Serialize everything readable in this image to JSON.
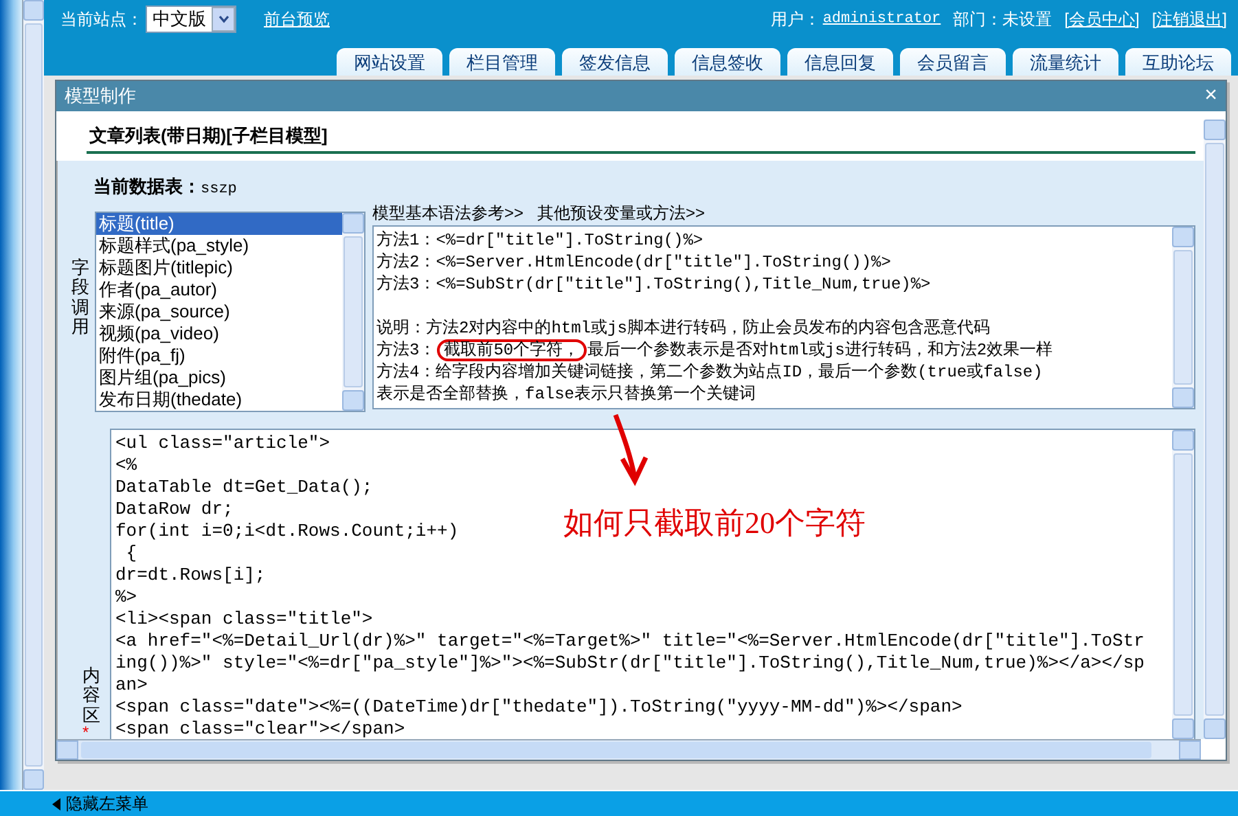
{
  "header": {
    "site_label": "当前站点：",
    "site_select": "中文版",
    "preview_link": "前台预览",
    "user_label": "用户：",
    "user_link": "administrator",
    "department": "部门：未设置",
    "member_center": "[会员中心]",
    "logout": "[注销退出]"
  },
  "tabs": [
    "网站设置",
    "栏目管理",
    "签发信息",
    "信息签收",
    "信息回复",
    "会员留言",
    "流量统计",
    "互助论坛"
  ],
  "dialog": {
    "title": "模型制作",
    "close": "×",
    "heading": "文章列表(带日期)[子栏目模型]",
    "table_label": "当前数据表：",
    "table_name": "sszp",
    "fields_label": "字段调用",
    "fields": [
      {
        "label": "标题(title)",
        "selected": true
      },
      {
        "label": "标题样式(pa_style)",
        "selected": false
      },
      {
        "label": "标题图片(titlepic)",
        "selected": false
      },
      {
        "label": "作者(pa_autor)",
        "selected": false
      },
      {
        "label": "来源(pa_source)",
        "selected": false
      },
      {
        "label": "视频(pa_video)",
        "selected": false
      },
      {
        "label": "附件(pa_fj)",
        "selected": false
      },
      {
        "label": "图片组(pa_pics)",
        "selected": false
      },
      {
        "label": "发布日期(thedate)",
        "selected": false
      }
    ],
    "syntax_links": [
      "模型基本语法参考>>",
      "其他预设变量或方法>>"
    ],
    "syntax_examples": [
      "方法1：<%=dr[\"title\"].ToString()%>",
      "方法2：<%=Server.HtmlEncode(dr[\"title\"].ToString())%>",
      "方法3：<%=SubStr(dr[\"title\"].ToString(),Title_Num,true)%>"
    ],
    "syntax_notes": [
      {
        "text": "说明：方法2对内容中的html或js脚本进行转码，防止会员发布的内容包含恶意代码"
      },
      {
        "text": "方法3：",
        "circled_text": "截取前50个字符，",
        "rest": "最后一个参数表示是否对html或js进行转码，和方法2效果一样"
      },
      {
        "text": "方法4：给字段内容增加关键词链接，第二个参数为站点ID，最后一个参数(true或false)"
      },
      {
        "text": "表示是否全部替换，false表示只替换第一个关键词"
      }
    ],
    "content_label": "内容区",
    "required_mark": "*",
    "code_lines": [
      "<ul class=\"article\">",
      "<%",
      "DataTable dt=Get_Data();",
      "DataRow dr;",
      "for(int i=0;i<dt.Rows.Count;i++)",
      " {",
      "dr=dt.Rows[i];",
      "%>",
      "<li><span class=\"title\">",
      "<a href=\"<%=Detail_Url(dr)%>\" target=\"<%=Target%>\" title=\"<%=Server.HtmlEncode(dr[\"title\"].ToStr",
      "ing())%>\" style=\"<%=dr[\"pa_style\"]%>\"><%=SubStr(dr[\"title\"].ToString(),Title_Num,true)%></a></sp",
      "an>",
      "<span class=\"date\"><%=((DateTime)dr[\"thedate\"]).ToString(\"yyyy-MM-dd\")%></span>",
      "<span class=\"clear\"></span>"
    ]
  },
  "annotation": {
    "text": "如何只截取前20个字符"
  },
  "bottom_bar": {
    "label": "隐藏左菜单"
  }
}
